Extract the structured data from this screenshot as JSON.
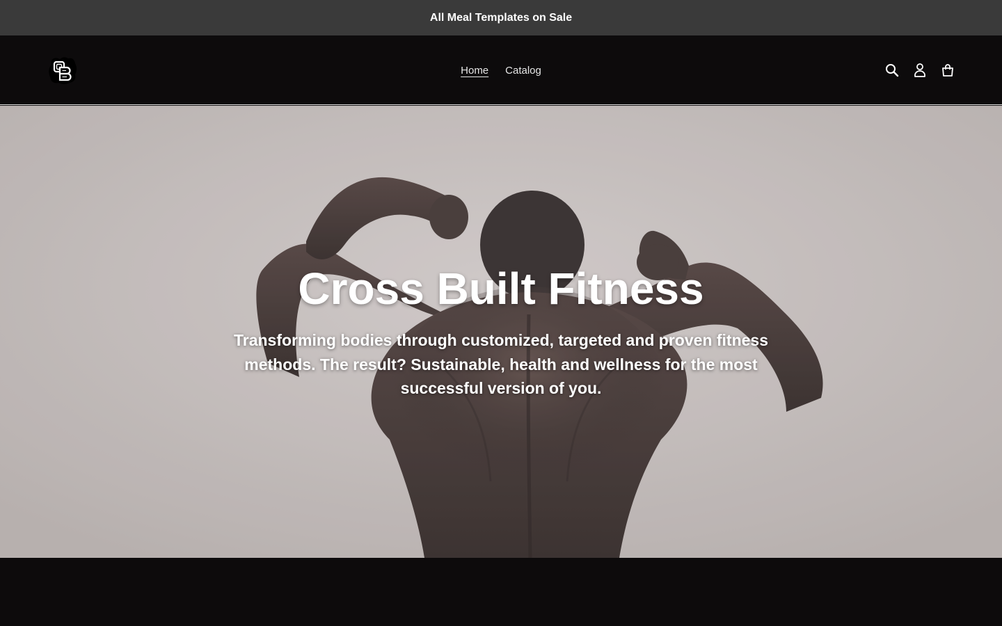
{
  "announcement": {
    "text": "All Meal Templates on Sale"
  },
  "header": {
    "logo_icon": "cb-monogram-logo",
    "nav": [
      {
        "label": "Home",
        "active": true
      },
      {
        "label": "Catalog",
        "active": false
      }
    ],
    "icons": [
      "search-icon",
      "account-icon",
      "cart-icon"
    ]
  },
  "hero": {
    "title": "Cross Built Fitness",
    "subtitle": "Transforming bodies through customized, targeted and proven fitness methods. The result? Sustainable, health and wellness for the most successful version of you.",
    "background_image": "muscular-back-flexing-photo"
  },
  "colors": {
    "announcement_bg": "#3a3a3a",
    "header_bg": "#0d0b0c",
    "hero_bg": "#bfb9b8",
    "text_on_dark": "#ffffff",
    "nav_text": "#e6e6e6"
  }
}
